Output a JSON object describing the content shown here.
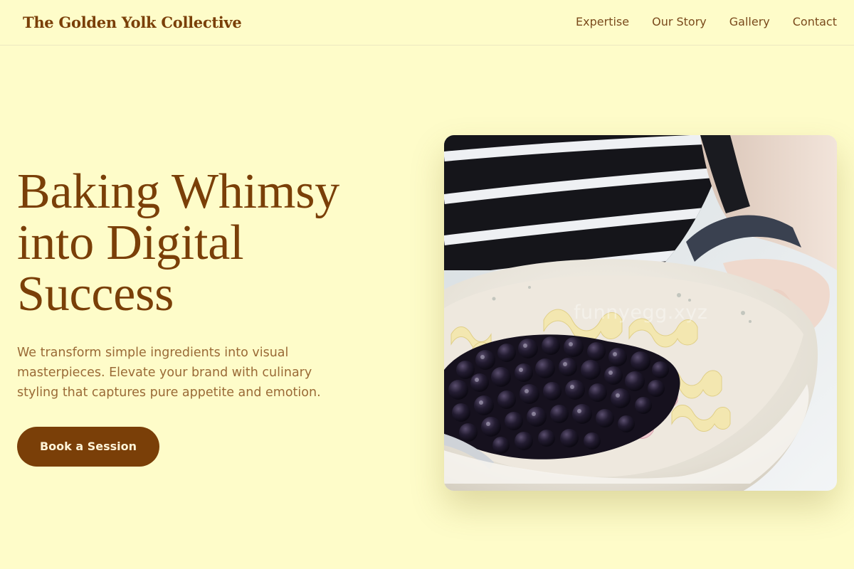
{
  "header": {
    "brand": "The Golden Yolk Collective",
    "nav": [
      {
        "label": "Expertise"
      },
      {
        "label": "Our Story"
      },
      {
        "label": "Gallery"
      },
      {
        "label": "Contact"
      }
    ]
  },
  "hero": {
    "title_lines": [
      "Baking Whimsy",
      "into Digital",
      "Success"
    ],
    "description": "We transform simple ingredients into visual masterpieces. Elevate your brand with culinary styling that captures pure appetite and emotion.",
    "cta_label": "Book a Session",
    "image": {
      "subject": "hand-holding-bowl-of-blueberries-and-pasta",
      "watermark": "funnyegg.xyz"
    }
  },
  "colors": {
    "background": "#fefcc9",
    "brand_brown": "#7a3f08",
    "text_muted": "#9a6a36",
    "nav_text": "#7a4a1c",
    "button_text": "#fff4d8"
  }
}
